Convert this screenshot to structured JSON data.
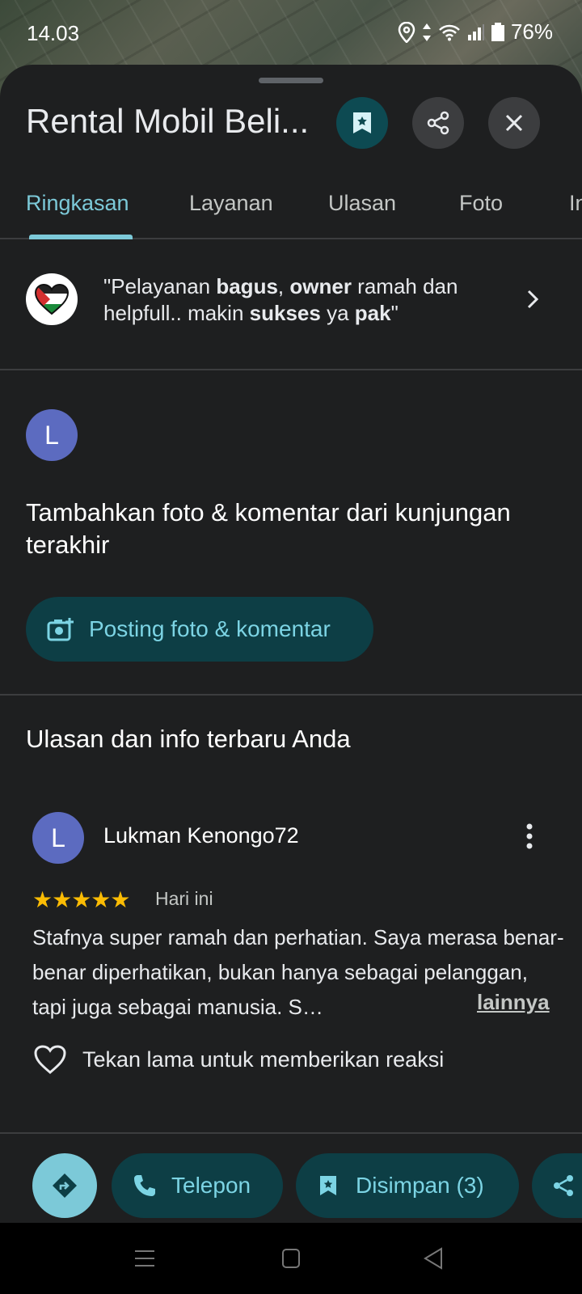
{
  "status_bar": {
    "time": "14.03",
    "battery": "76%"
  },
  "header": {
    "title": "Rental Mobil Beli..."
  },
  "tabs": [
    {
      "label": "Ringkasan"
    },
    {
      "label": "Layanan"
    },
    {
      "label": "Ulasan"
    },
    {
      "label": "Foto"
    },
    {
      "label": "In"
    }
  ],
  "highlight_quote": {
    "open": "\"Pelayanan ",
    "b1": "bagus",
    "t1": ", ",
    "b2": "owner",
    "t2": " ramah dan helpfull.. makin ",
    "b3": "sukses",
    "t3": " ya ",
    "b4": "pak",
    "close": "\""
  },
  "user_avatar_letter": "L",
  "add_prompt": {
    "title": "Tambahkan foto & komentar dari kunjungan terakhir",
    "button_label": "Posting foto & komentar"
  },
  "recent": {
    "title": "Ulasan dan info terbaru Anda",
    "review": {
      "avatar_letter": "L",
      "author": "Lukman Kenongo72",
      "stars": "★★★★★",
      "rating": 5,
      "date": "Hari ini",
      "text": "Stafnya super ramah dan perhatian. Saya merasa benar-benar diperhatikan, bukan hanya sebagai pelanggan, tapi juga sebagai manusia. S…",
      "more_label": "lainnya",
      "react_label": "Tekan lama untuk memberikan reaksi"
    }
  },
  "actions": {
    "call_label": "Telepon",
    "saved_label": "Disimpan (3)"
  },
  "colors": {
    "accent": "#7cc9d8",
    "pill_bg": "#0d3e45",
    "star": "#fbbc04",
    "avatar": "#5c6bc0"
  }
}
